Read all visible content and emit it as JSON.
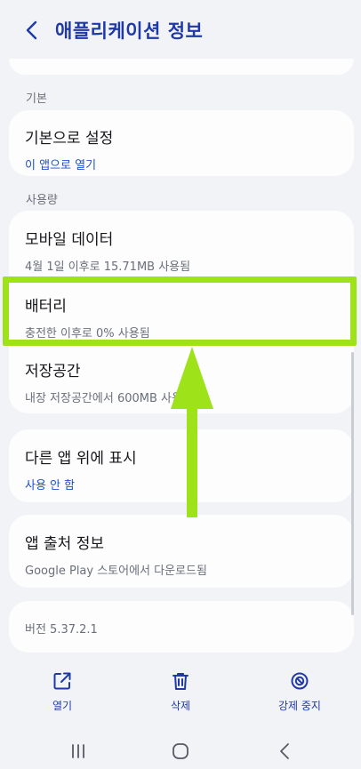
{
  "header": {
    "title": "애플리케이션 정보"
  },
  "sections": {
    "basic_label": "기본",
    "usage_label": "사용량"
  },
  "default_setting": {
    "title": "기본으로 설정",
    "subtitle": "이 앱으로 열기"
  },
  "usage_items": [
    {
      "title": "모바일 데이터",
      "subtitle": "4월 1일 이후로 15.71MB 사용됨"
    },
    {
      "title": "배터리",
      "subtitle": "충전한 이후로 0% 사용됨"
    },
    {
      "title": "저장공간",
      "subtitle": "내장 저장공간에서 600MB 사용됨"
    }
  ],
  "overlay": {
    "title": "다른 앱 위에 표시",
    "subtitle": "사용 안 함"
  },
  "source": {
    "title": "앱 출처 정보",
    "subtitle": "Google Play 스토어에서 다운로드됨"
  },
  "version": {
    "text": "버전 5.37.2.1"
  },
  "actions": [
    {
      "label": "열기",
      "icon": "open-external-icon"
    },
    {
      "label": "삭제",
      "icon": "trash-icon"
    },
    {
      "label": "강제 중지",
      "icon": "block-icon"
    }
  ],
  "colors": {
    "accent": "#1f3aa6",
    "highlight": "#9ee21a",
    "background": "#f2f3f7"
  }
}
